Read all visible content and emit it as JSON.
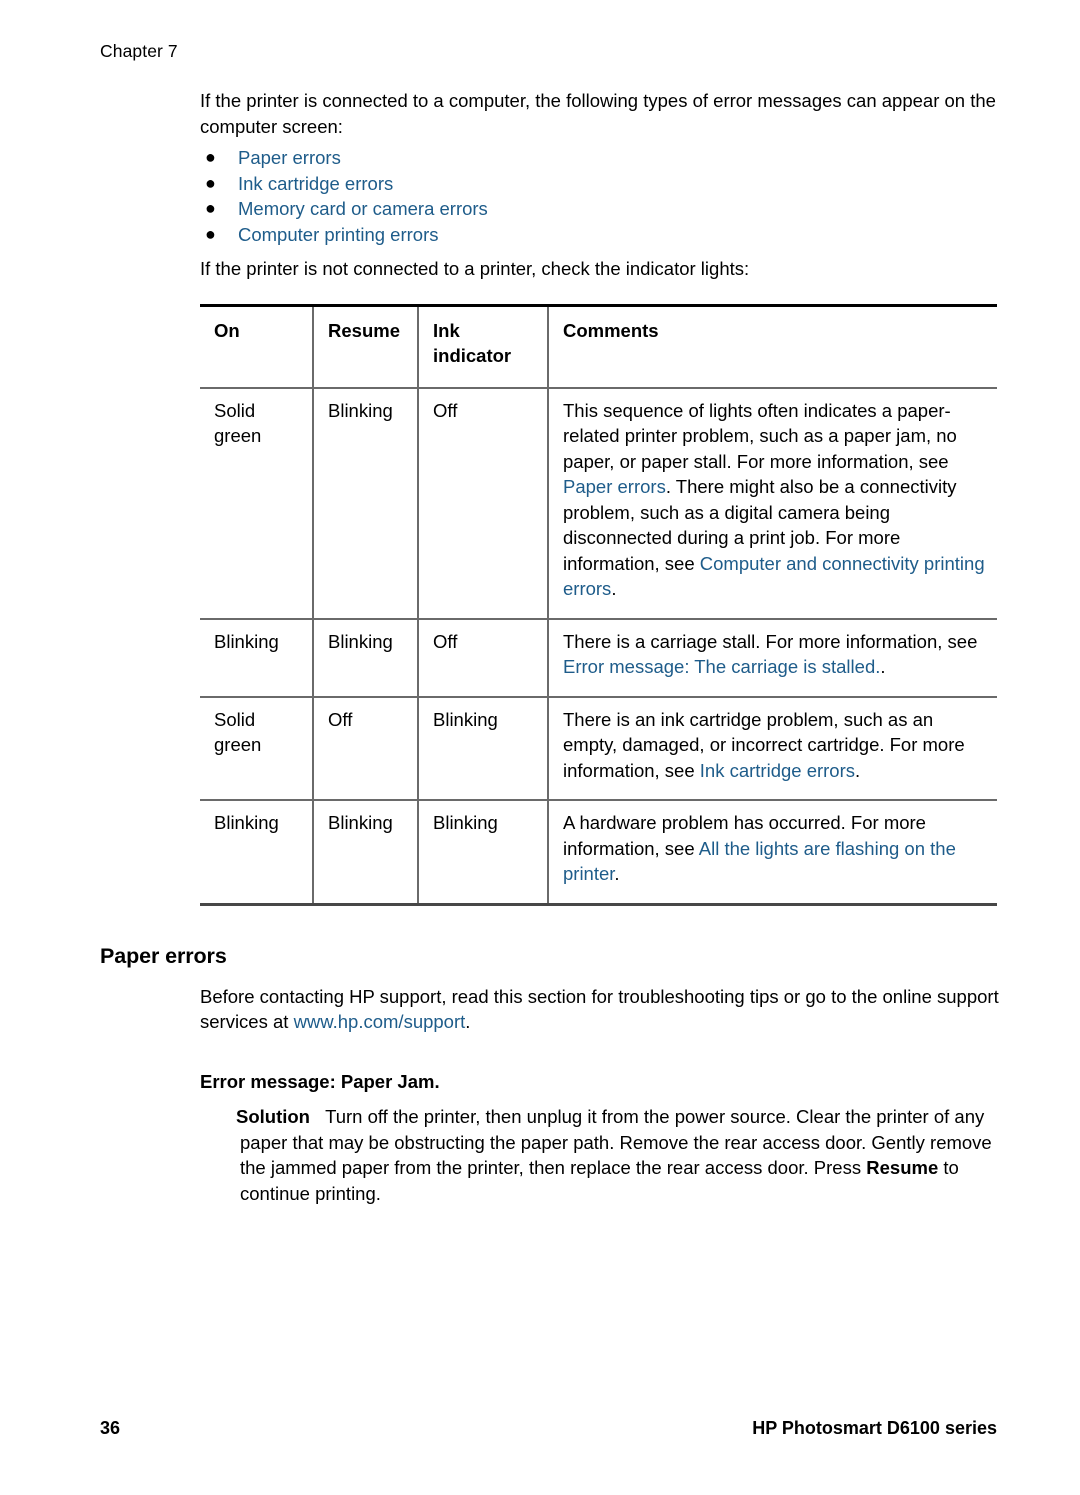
{
  "page": {
    "running_head": "Chapter 7",
    "page_number": "36",
    "product_name": "HP Photosmart D6100 series",
    "link_color": "#1e5c8a",
    "text_color": "#000000",
    "background_color": "#ffffff"
  },
  "intro": {
    "paragraph": "If the printer is connected to a computer, the following types of error messages can appear on the computer screen:",
    "bullets": [
      {
        "label": "Paper errors"
      },
      {
        "label": "Ink cartridge errors"
      },
      {
        "label": "Memory card or camera errors"
      },
      {
        "label": "Computer printing errors"
      }
    ],
    "after_bullets": "If the printer is not connected to a printer, check the indicator lights:"
  },
  "lights_table": {
    "headers": [
      "On",
      "Resume",
      "Ink indicator",
      "Comments"
    ],
    "rows": [
      {
        "on": "Solid green",
        "resume": "Blinking",
        "ink": "Off",
        "comments_parts": [
          {
            "text": "This sequence of lights often indicates a paper-related printer problem, such as a paper jam, no paper, or paper stall. For more information, see ",
            "link": false
          },
          {
            "text": "Paper errors",
            "link": true
          },
          {
            "text": ". There might also be a connectivity problem, such as a digital camera being disconnected during a print job. For more information, see ",
            "link": false
          },
          {
            "text": "Computer and connectivity printing errors",
            "link": true
          },
          {
            "text": ".",
            "link": false
          }
        ]
      },
      {
        "on": "Blinking",
        "resume": "Blinking",
        "ink": "Off",
        "comments_parts": [
          {
            "text": "There is a carriage stall. For more information, see ",
            "link": false
          },
          {
            "text": "Error message: The carriage is stalled.",
            "link": true
          },
          {
            "text": ".",
            "link": false
          }
        ]
      },
      {
        "on": "Solid green",
        "resume": "Off",
        "ink": "Blinking",
        "comments_parts": [
          {
            "text": "There is an ink cartridge problem, such as an empty, damaged, or incorrect cartridge. For more information, see ",
            "link": false
          },
          {
            "text": "Ink cartridge errors",
            "link": true
          },
          {
            "text": ".",
            "link": false
          }
        ]
      },
      {
        "on": "Blinking",
        "resume": "Blinking",
        "ink": "Blinking",
        "comments_parts": [
          {
            "text": "A hardware problem has occurred. For more information, see ",
            "link": false
          },
          {
            "text": "All the lights are flashing on the printer",
            "link": true
          },
          {
            "text": ".",
            "link": false
          }
        ]
      }
    ]
  },
  "paper_errors_section": {
    "heading": "Paper errors",
    "intro_parts": [
      {
        "text": "Before contacting HP support, read this section for troubleshooting tips or go to the online support services at ",
        "link": false
      },
      {
        "text": "www.hp.com/support",
        "link": true
      },
      {
        "text": ".",
        "link": false
      }
    ],
    "error_heading": "Error message: Paper Jam.",
    "solution_label": "Solution",
    "solution_parts": [
      {
        "text": "Turn off the printer, then unplug it from the power source. Clear the printer of any paper that may be obstructing the paper path. Remove the rear access door. Gently remove the jammed paper from the printer, then replace the rear access door. Press ",
        "bold": false
      },
      {
        "text": "Resume",
        "bold": true
      },
      {
        "text": " to continue printing.",
        "bold": false
      }
    ]
  }
}
